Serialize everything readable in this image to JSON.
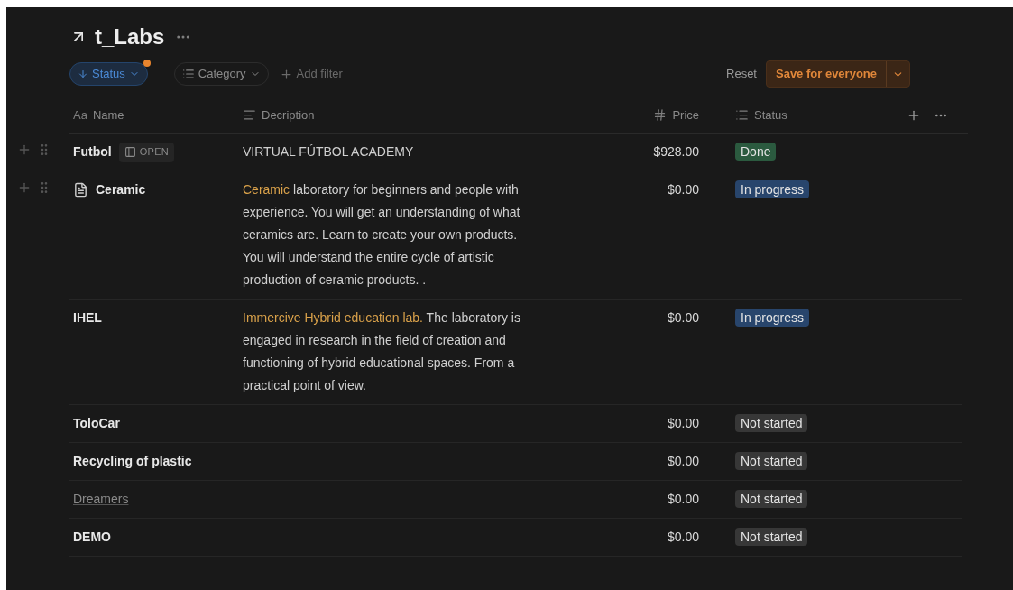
{
  "title": "t_Labs",
  "filters": [
    {
      "kind": "sort",
      "label": "Status",
      "active": true
    },
    {
      "kind": "select",
      "label": "Category",
      "active": false
    }
  ],
  "add_filter": "Add filter",
  "reset": "Reset",
  "save": "Save for everyone",
  "columns": [
    {
      "kind": "title",
      "label": "Name",
      "type_label": "Aa"
    },
    {
      "kind": "text",
      "label": "Decription"
    },
    {
      "kind": "number",
      "label": "Price"
    },
    {
      "kind": "select",
      "label": "Status"
    }
  ],
  "rows": [
    {
      "name": "Futbol",
      "dimmed": false,
      "handles": true,
      "page": false,
      "open": "OPEN",
      "highlight": "",
      "text": "VIRTUAL FÚTBOL ACADEMY",
      "price": "$928.00",
      "status": "Done",
      "color": "#2b5a3f"
    },
    {
      "name": "Ceramic",
      "dimmed": false,
      "handles": true,
      "page": true,
      "highlight": "Ceramic",
      "text": " laboratory for beginners and people with experience. You will get an understanding of what ceramics are. Learn to create your own products. You will understand the entire cycle of artistic production of ceramic products. .",
      "price": "$0.00",
      "status": "In progress",
      "color": "#28456c"
    },
    {
      "name": "IHEL",
      "dimmed": false,
      "handles": false,
      "page": false,
      "highlight": "Immercive Hybrid education lab.",
      "text": " The laboratory is engaged in research in the field of creation and functioning of hybrid educational spaces. From a practical point of view.",
      "price": "$0.00",
      "status": "In progress",
      "color": "#28456c"
    },
    {
      "name": "ToloCar",
      "dimmed": false,
      "handles": false,
      "page": false,
      "price": "$0.00",
      "status": "Not started",
      "color": "#373737"
    },
    {
      "name": "Recycling of plastic",
      "dimmed": false,
      "handles": false,
      "page": false,
      "price": "$0.00",
      "status": "Not started",
      "color": "#373737"
    },
    {
      "name": "Dreamers",
      "dimmed": true,
      "handles": false,
      "page": false,
      "price": "$0.00",
      "status": "Not started",
      "color": "#373737"
    },
    {
      "name": "DEMO",
      "dimmed": false,
      "handles": false,
      "page": false,
      "price": "$0.00",
      "status": "Not started",
      "color": "#373737"
    }
  ]
}
